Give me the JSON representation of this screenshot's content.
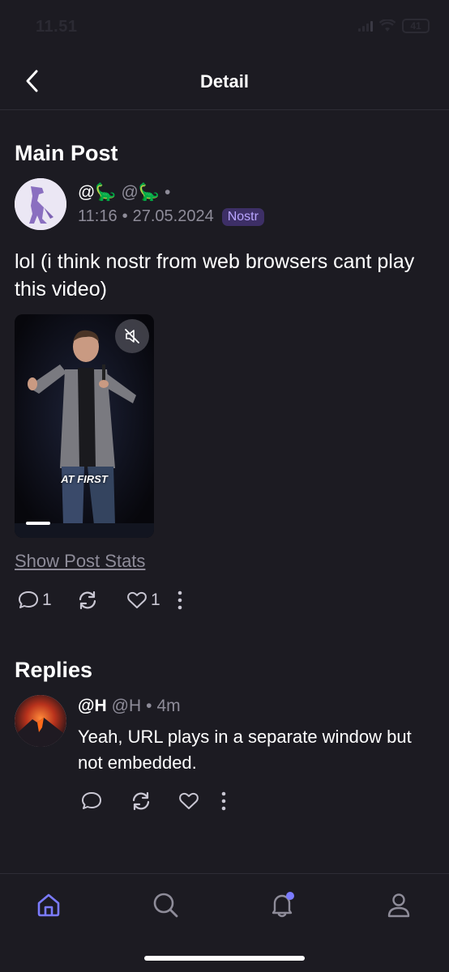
{
  "status_bar": {
    "time": "11.51",
    "battery": "41"
  },
  "header": {
    "title": "Detail"
  },
  "main_post": {
    "section_title": "Main Post",
    "author_name": "@🦕",
    "author_handle": "@🦕",
    "time": "11:16",
    "date": "27.05.2024",
    "badge": "Nostr",
    "text": "lol (i think nostr from web browsers cant play this video)",
    "video_caption": "AT FIRST",
    "stats_link": "Show Post Stats",
    "comment_count": "1",
    "like_count": "1"
  },
  "replies": {
    "section_title": "Replies",
    "items": [
      {
        "author_name": "@H",
        "author_handle": "@H",
        "age": "4m",
        "text": "Yeah, URL plays in a separate window but not embedded."
      }
    ]
  },
  "bottom_nav": {
    "items": [
      "home",
      "search",
      "notifications",
      "profile"
    ],
    "active": "home",
    "accent": "#7b7bff"
  }
}
